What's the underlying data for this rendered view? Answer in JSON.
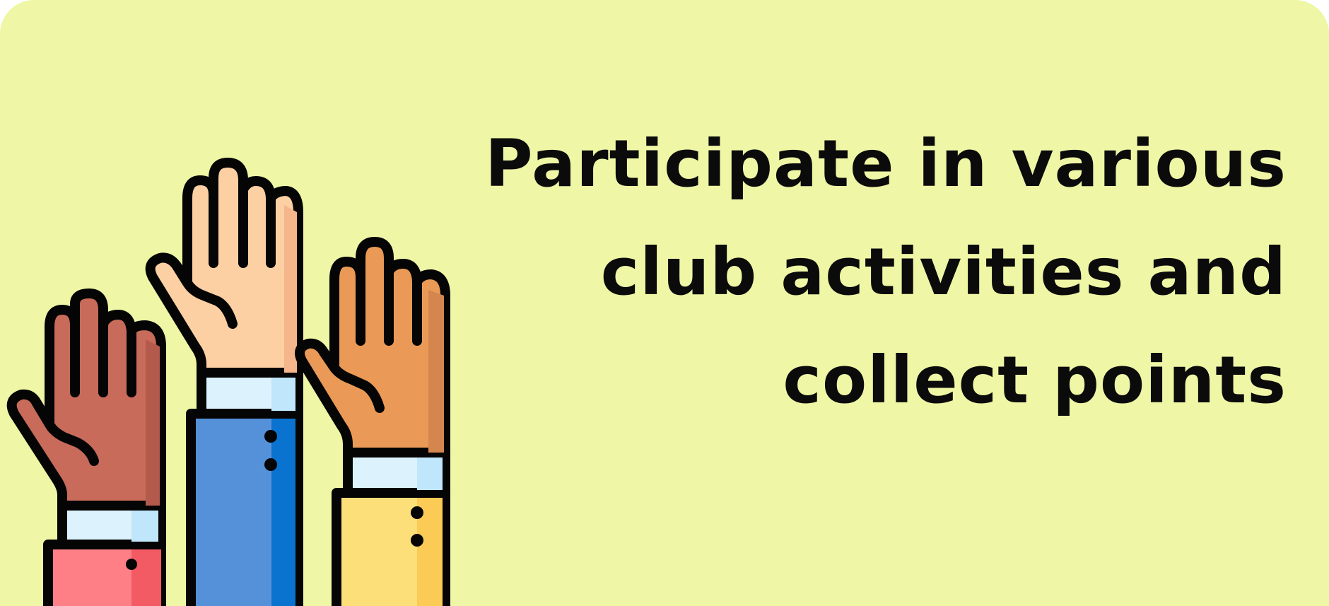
{
  "banner": {
    "headline_lines": [
      "Participate in various",
      "club activities and",
      "collect points"
    ],
    "illustration_icon": "raised-hands-icon"
  },
  "colors": {
    "background": "#eff6a5",
    "text": "#0b0b0b",
    "outline": "#050505",
    "hand_left": "#c86b5a",
    "hand_left_shade": "#b45a4c",
    "sleeve_left": "#ff7f86",
    "hand_center": "#fdd0a4",
    "hand_center_shade": "#f4b68a",
    "sleeve_center": "#5591d9",
    "sleeve_center_shade": "#0a73d0",
    "hand_right": "#ea9a56",
    "hand_right_shade": "#d5864f",
    "sleeve_right": "#fddf7a",
    "sleeve_right_shade": "#fbcb55",
    "cuff": "#dcf3fd",
    "cuff_shade": "#bfe6fb"
  }
}
